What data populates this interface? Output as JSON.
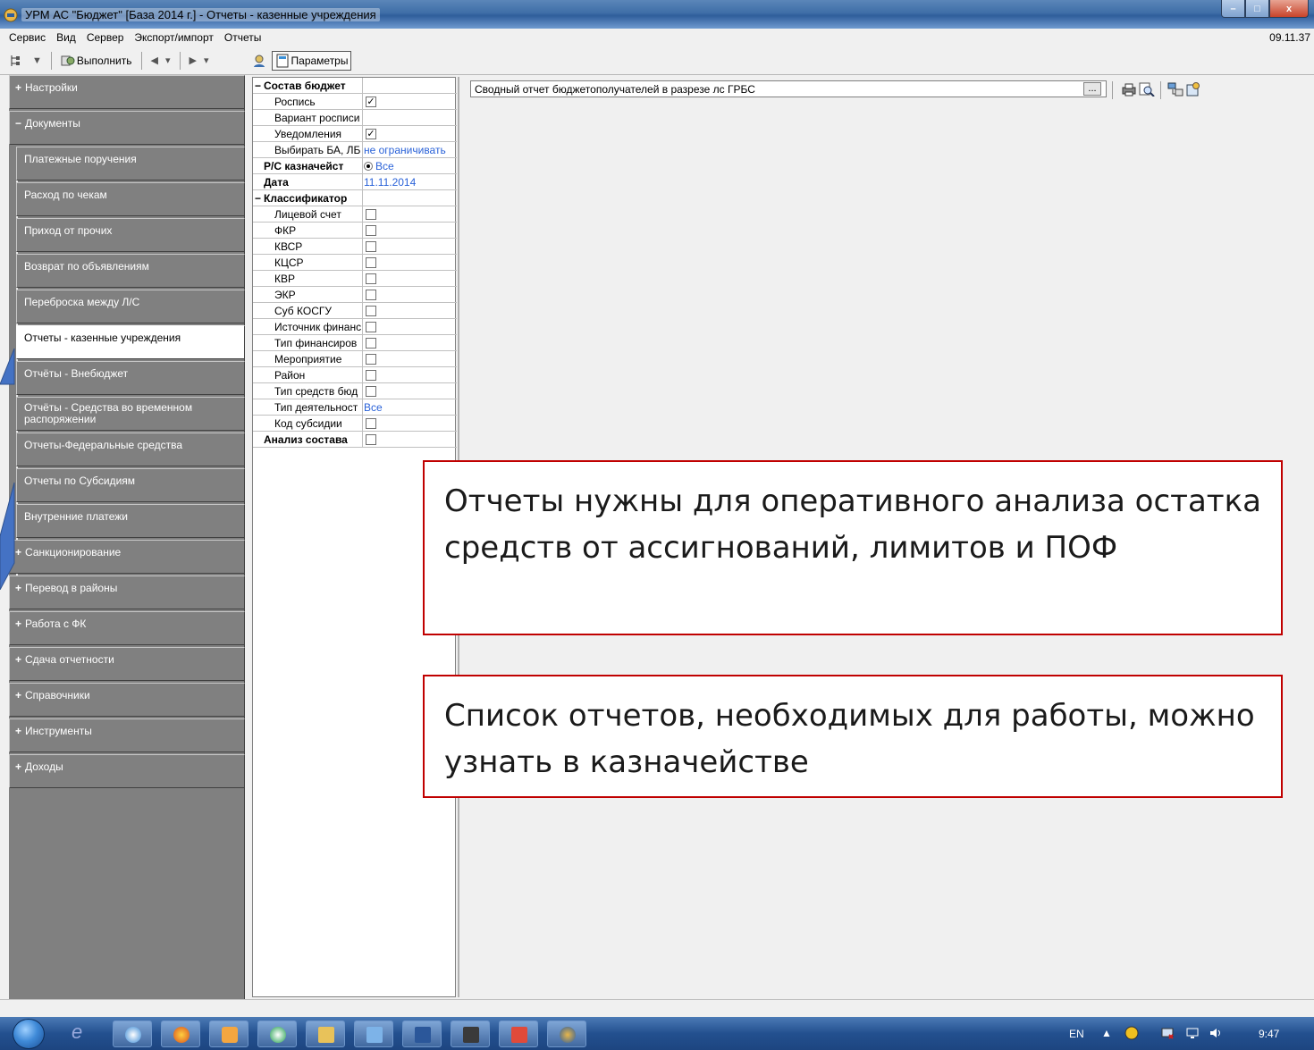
{
  "window": {
    "title": "УРМ АС \"Бюджет\" [База 2014 г.] - Отчеты - казенные учреждения",
    "controls": {
      "minimize": "–",
      "maximize": "□",
      "close": "x"
    }
  },
  "menu": {
    "items": [
      "Сервис",
      "Вид",
      "Сервер",
      "Экспорт/импорт",
      "Отчеты"
    ],
    "clock": "09.11.37"
  },
  "toolbar": {
    "execute_label": "Выполнить",
    "params_label": "Параметры"
  },
  "nav": {
    "items": [
      {
        "label": "Настройки",
        "marker": "+"
      },
      {
        "label": "Документы",
        "marker": "−"
      },
      {
        "label": "Платежные поручения"
      },
      {
        "label": "Расход по чекам"
      },
      {
        "label": "Приход от прочих"
      },
      {
        "label": "Возврат по объявлениям"
      },
      {
        "label": "Переброска между Л/С"
      },
      {
        "label": "Отчеты - казенные учреждения"
      },
      {
        "label": "Отчёты - Внебюджет"
      },
      {
        "label": "Отчёты - Средства во временном распоряжении"
      },
      {
        "label": "Отчеты-Федеральные средства"
      },
      {
        "label": "Отчеты по Субсидиям"
      },
      {
        "label": "Внутренние платежи"
      },
      {
        "label": "Санкционирование",
        "marker": "+"
      },
      {
        "label": "Перевод в районы",
        "marker": "+"
      },
      {
        "label": "Работа с ФК",
        "marker": "+"
      },
      {
        "label": "Сдача отчетности",
        "marker": "+"
      },
      {
        "label": "Справочники",
        "marker": "+"
      },
      {
        "label": "Инструменты",
        "marker": "+"
      },
      {
        "label": "Доходы",
        "marker": "+"
      }
    ]
  },
  "params": {
    "rows": [
      {
        "label": "Состав бюджет",
        "marker": "−"
      },
      {
        "label": "Роспись",
        "checked": "✓"
      },
      {
        "label": "Вариант росписи"
      },
      {
        "label": "Уведомления",
        "checked": "✓"
      },
      {
        "label": "Выбирать БА, ЛБ",
        "value": "не ограничивать"
      },
      {
        "label": "Р/С казначейст",
        "value": "Все"
      },
      {
        "label": "Дата",
        "value": "11.11.2014"
      },
      {
        "label": "Классификатор",
        "marker": "−"
      },
      {
        "label": "Лицевой счет",
        "checked": ""
      },
      {
        "label": "ФКР",
        "checked": ""
      },
      {
        "label": "КВСР",
        "checked": ""
      },
      {
        "label": "КЦСР",
        "checked": ""
      },
      {
        "label": "КВР",
        "checked": ""
      },
      {
        "label": "ЭКР",
        "checked": ""
      },
      {
        "label": "Суб КОСГУ",
        "checked": ""
      },
      {
        "label": "Источник финанс",
        "checked": ""
      },
      {
        "label": "Тип финансиров",
        "checked": ""
      },
      {
        "label": "Мероприятие",
        "checked": ""
      },
      {
        "label": "Район",
        "checked": ""
      },
      {
        "label": "Тип средств бюд",
        "checked": ""
      },
      {
        "label": "Тип деятельност",
        "value": "Все"
      },
      {
        "label": "Код субсидии",
        "checked": ""
      },
      {
        "label": "Анализ состава",
        "checked": ""
      }
    ]
  },
  "report": {
    "selected": "Сводный отчет бюджетополучателей в разрезе лс ГРБС",
    "combo_button": "..."
  },
  "callouts": {
    "first": "Отчеты нужны для оперативного анализа остатка средств от ассигнований, лимитов и ПОФ",
    "second": "Список отчетов, необходимых для работы, можно узнать в казначействе"
  },
  "taskbar": {
    "lang": "EN",
    "tray_arrow": "▲",
    "time": "9:47"
  }
}
